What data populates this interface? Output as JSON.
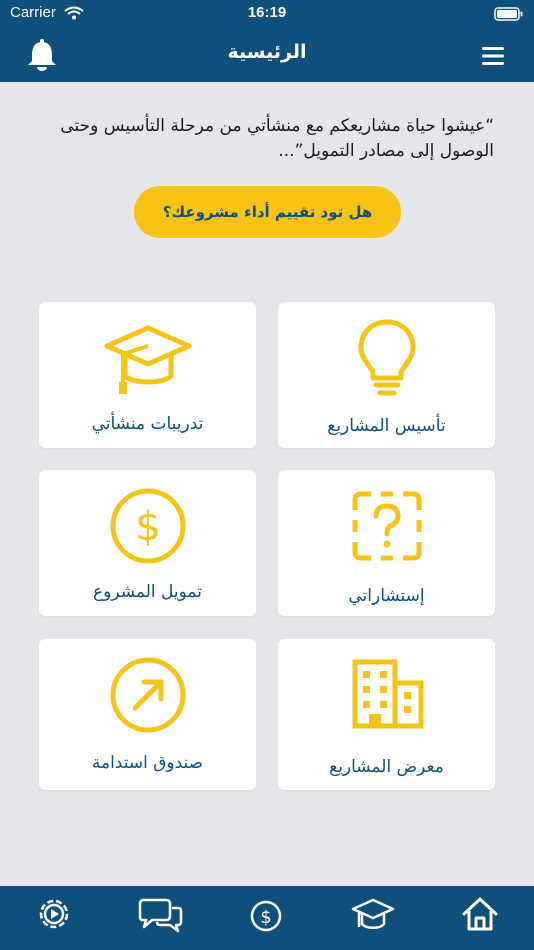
{
  "status_bar": {
    "carrier": "Carrier",
    "time": "16:19"
  },
  "header": {
    "title": "الرئيسية"
  },
  "intro": {
    "quote": "“عيشوا حياة مشاريعكم مع منشأتي من مرحلة التأسيس وحتى الوصول إلى مصادر التمويل”..."
  },
  "cta": {
    "label": "هل تود تقييم أداء مشروعك؟"
  },
  "cards": [
    {
      "label": "تأسيس المشاريع",
      "icon": "lightbulb-icon"
    },
    {
      "label": "تدريبات منشأتي",
      "icon": "graduation-cap-icon"
    },
    {
      "label": "إستشاراتي",
      "icon": "question-icon"
    },
    {
      "label": "تمويل المشروع",
      "icon": "dollar-icon"
    },
    {
      "label": "معرض المشاريع",
      "icon": "building-icon"
    },
    {
      "label": "صندوق استدامة",
      "icon": "arrow-up-right-icon"
    }
  ],
  "tab_bar": {
    "icons": [
      "settings-icon",
      "chat-icon",
      "dollar-icon",
      "graduation-cap-icon",
      "home-icon"
    ]
  },
  "colors": {
    "primary": "#0e4f7c",
    "accent": "#f7c415",
    "background": "#e5e6ea"
  }
}
